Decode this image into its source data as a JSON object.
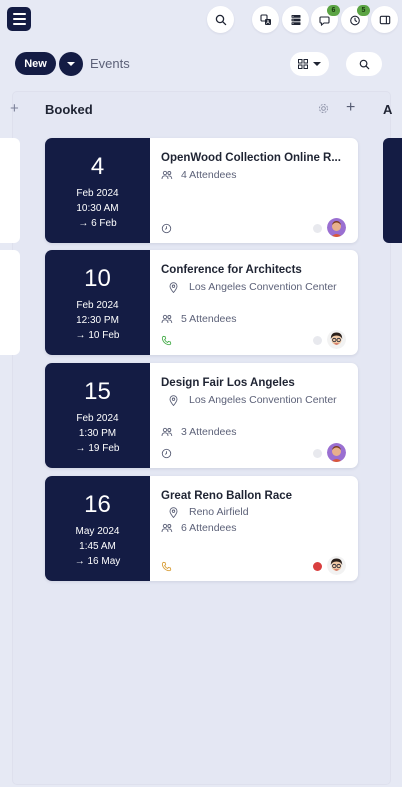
{
  "header": {
    "menu_icon": "hamburger-menu-icon",
    "search_icon": "search-icon",
    "buttons": [
      {
        "name": "translate-icon",
        "badge": ""
      },
      {
        "name": "server-icon",
        "badge": ""
      },
      {
        "name": "chat-icon",
        "badge": "6"
      },
      {
        "name": "timer-icon",
        "badge": "5"
      },
      {
        "name": "sidebar-panel-icon",
        "badge": ""
      }
    ]
  },
  "toolbar": {
    "new_label": "New",
    "events_label": "Events",
    "view_icon": "grid-view-icon",
    "search_icon": "search-icon"
  },
  "column": {
    "title": "Booked",
    "next_title": "A",
    "gear_icon": "gear-icon",
    "add_icon": "plus-icon"
  },
  "events": [
    {
      "day": "4",
      "month_year": "Feb 2024",
      "time": "10:30 AM",
      "end": "6 Feb",
      "title": "OpenWood Collection Online R...",
      "location": "",
      "attendees": "4 Attendees",
      "bottom_icon": "clock-icon",
      "status_color": "#e8e9ee",
      "avatar": "purple"
    },
    {
      "day": "10",
      "month_year": "Feb 2024",
      "time": "12:30 PM",
      "end": "10 Feb",
      "title": "Conference for Architects",
      "location": "Los Angeles Convention Center",
      "attendees": "5 Attendees",
      "bottom_icon": "phone-icon",
      "status_color": "#e8e9ee",
      "avatar": "glasses"
    },
    {
      "day": "15",
      "month_year": "Feb 2024",
      "time": "1:30 PM",
      "end": "19 Feb",
      "title": "Design Fair Los Angeles",
      "location": "Los Angeles Convention Center",
      "attendees": "3 Attendees",
      "bottom_icon": "clock-icon",
      "status_color": "#e8e9ee",
      "avatar": "purple"
    },
    {
      "day": "16",
      "month_year": "May 2024",
      "time": "1:45 AM",
      "end": "16 May",
      "title": "Great Reno Ballon Race",
      "location": "Reno Airfield",
      "attendees": "6 Attendees",
      "bottom_icon": "phone-icon",
      "status_color": "#d93f3f",
      "avatar": "glasses"
    }
  ],
  "colors": {
    "navy": "#141c44",
    "background": "#e6e9f4",
    "badge_green": "#5ba444",
    "phone_green": "#4caf50",
    "phone_orange": "#d9a03c"
  }
}
